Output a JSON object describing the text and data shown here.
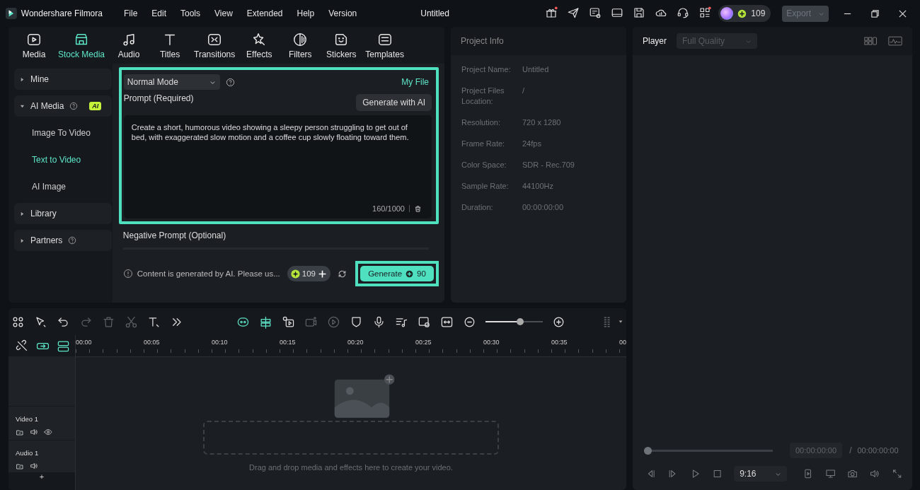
{
  "app": {
    "name": "Wondershare Filmora",
    "menus": [
      "File",
      "Edit",
      "Tools",
      "View",
      "Extended",
      "Help",
      "Version"
    ],
    "title": "Untitled",
    "credits": "109",
    "export": "Export"
  },
  "tabs": [
    {
      "label": "Media",
      "selected": false
    },
    {
      "label": "Stock Media",
      "selected": true
    },
    {
      "label": "Audio",
      "selected": false
    },
    {
      "label": "Titles",
      "selected": false
    },
    {
      "label": "Transitions",
      "selected": false
    },
    {
      "label": "Effects",
      "selected": false
    },
    {
      "label": "Filters",
      "selected": false
    },
    {
      "label": "Stickers",
      "selected": false
    },
    {
      "label": "Templates",
      "selected": false
    }
  ],
  "sidebar": [
    {
      "label": "Mine",
      "expanded": false,
      "help": false
    },
    {
      "label": "AI Media",
      "expanded": true,
      "help": true,
      "badge": "AI",
      "children": [
        {
          "label": "Image To Video",
          "selected": false
        },
        {
          "label": "Text to Video",
          "selected": true
        },
        {
          "label": "AI Image",
          "selected": false
        }
      ]
    },
    {
      "label": "Library",
      "expanded": false,
      "help": false
    },
    {
      "label": "Partners",
      "expanded": false,
      "help": true
    }
  ],
  "ai_panel": {
    "mode": "Normal Mode",
    "my_file": "My File",
    "prompt_label": "Prompt (Required)",
    "generate_with_ai": "Generate with AI",
    "prompt": "Create a short, humorous video showing a sleepy person struggling to get out of bed, with exaggerated slow motion and a coffee cup slowly floating toward them.",
    "char_count": "160/1000",
    "negative_label": "Negative Prompt (Optional)",
    "notice": "Content is generated by AI. Please us...",
    "credits": "109",
    "generate": {
      "label": "Generate",
      "cost": "90"
    }
  },
  "project_info": {
    "title": "Project Info",
    "rows": [
      {
        "label": "Project Name:",
        "value": "Untitled"
      },
      {
        "label": "Project Files Location:",
        "value": "/"
      },
      {
        "label": "Resolution:",
        "value": "720 x 1280"
      },
      {
        "label": "Frame Rate:",
        "value": "24fps"
      },
      {
        "label": "Color Space:",
        "value": "SDR - Rec.709"
      },
      {
        "label": "Sample Rate:",
        "value": "44100Hz"
      },
      {
        "label": "Duration:",
        "value": "00:00:00:00"
      }
    ]
  },
  "player": {
    "title": "Player",
    "quality": "Full Quality",
    "level": 0,
    "time_current": "00:00:00:00",
    "separator": "/",
    "time_total": "00:00:00:00",
    "ratio": "9:16"
  },
  "timeline": {
    "zoom": {
      "level": 0.62
    },
    "ruler": [
      "00:00",
      "00:05",
      "00:10",
      "00:15",
      "00:20",
      "00:25",
      "00:30",
      "00:35",
      "00"
    ],
    "tracks": [
      {
        "name": "Video 1",
        "kind": "video"
      },
      {
        "name": "Audio 1",
        "kind": "audio"
      }
    ],
    "add_track": "+",
    "drop_hint": "Drag and drop media and effects here to create your video."
  }
}
